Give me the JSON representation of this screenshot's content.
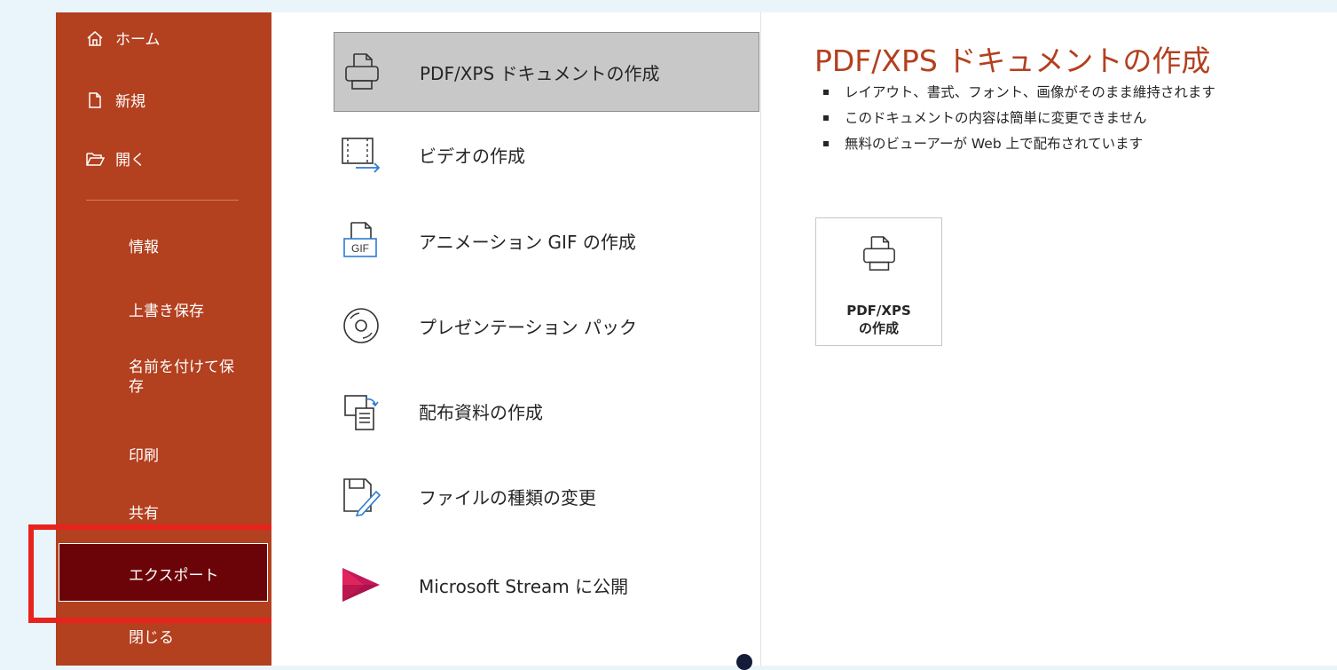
{
  "colors": {
    "accent": "#b3401f",
    "selected": "#6b0408",
    "highlight": "#e8231d"
  },
  "sidebar": {
    "top_items": [
      {
        "label": "ホーム",
        "icon": "home-icon"
      },
      {
        "label": "新規",
        "icon": "new-document-icon"
      },
      {
        "label": "開く",
        "icon": "folder-open-icon"
      }
    ],
    "items": [
      {
        "label": "情報"
      },
      {
        "label": "上書き保存"
      },
      {
        "label": "名前を付けて保\n存"
      },
      {
        "label": "印刷"
      },
      {
        "label": "共有"
      },
      {
        "label": "エクスポート",
        "selected": true
      },
      {
        "label": "閉じる"
      }
    ]
  },
  "export_options": [
    {
      "label": "PDF/XPS ドキュメントの作成",
      "icon": "pdf-document-icon",
      "selected": true
    },
    {
      "label": "ビデオの作成",
      "icon": "video-icon"
    },
    {
      "label": "アニメーション GIF の作成",
      "icon": "gif-icon"
    },
    {
      "label": "プレゼンテーション パック",
      "icon": "disc-icon"
    },
    {
      "label": "配布資料の作成",
      "icon": "handout-icon"
    },
    {
      "label": "ファイルの種類の変更",
      "icon": "change-filetype-icon"
    },
    {
      "label": "Microsoft Stream に公開",
      "icon": "stream-icon"
    }
  ],
  "detail": {
    "title": "PDF/XPS ドキュメントの作成",
    "bullets": [
      "レイアウト、書式、フォント、画像がそのまま維持されます",
      "このドキュメントの内容は簡単に変更できません",
      "無料のビューアーが Web 上で配布されています"
    ],
    "button_line1": "PDF/XPS",
    "button_line2": "の作成"
  }
}
